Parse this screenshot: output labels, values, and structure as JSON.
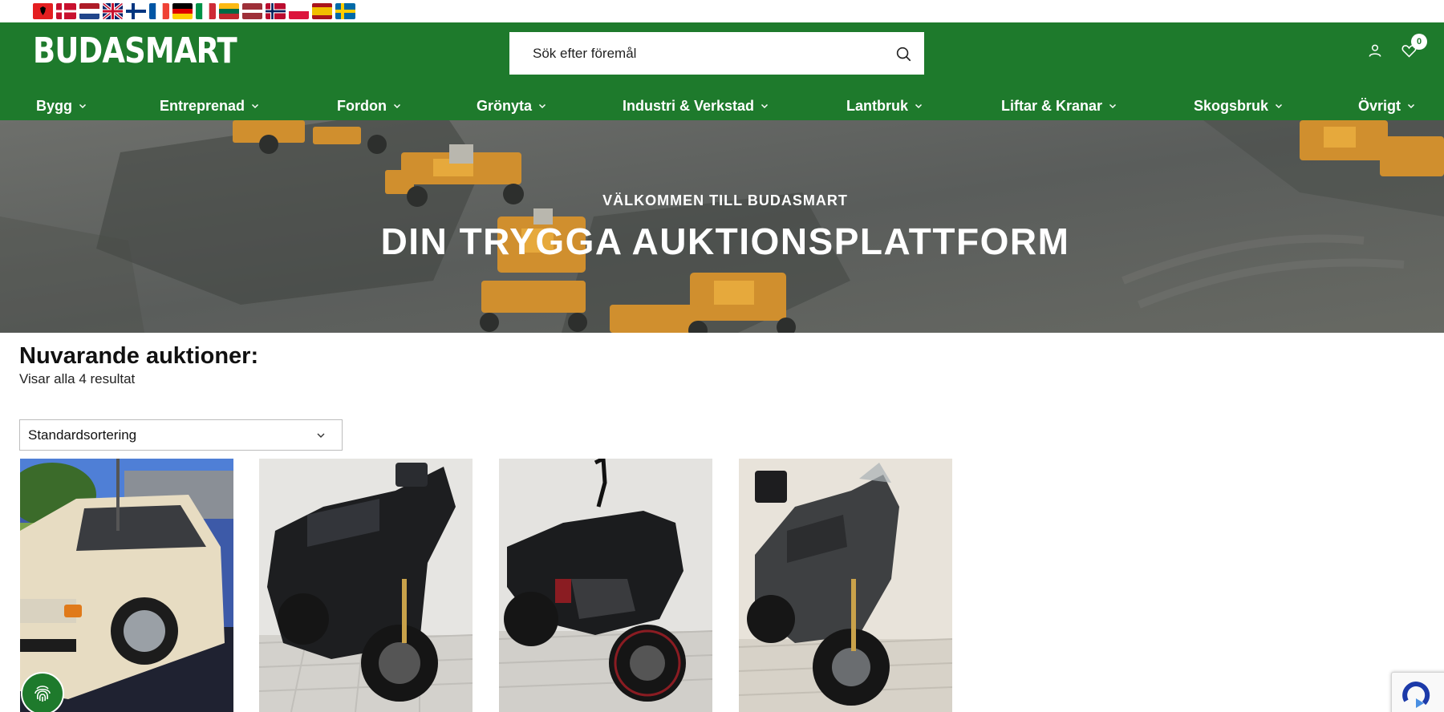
{
  "languages": [
    {
      "name": "albanian-flag",
      "code": "sq"
    },
    {
      "name": "danish-flag",
      "code": "da"
    },
    {
      "name": "dutch-flag",
      "code": "nl"
    },
    {
      "name": "english-flag",
      "code": "en"
    },
    {
      "name": "finnish-flag",
      "code": "fi"
    },
    {
      "name": "french-flag",
      "code": "fr"
    },
    {
      "name": "german-flag",
      "code": "de"
    },
    {
      "name": "italian-flag",
      "code": "it"
    },
    {
      "name": "lithuanian-flag",
      "code": "lt"
    },
    {
      "name": "latvian-flag",
      "code": "lv"
    },
    {
      "name": "norwegian-flag",
      "code": "no"
    },
    {
      "name": "polish-flag",
      "code": "pl"
    },
    {
      "name": "spanish-flag",
      "code": "es"
    },
    {
      "name": "swedish-flag",
      "code": "sv"
    }
  ],
  "header": {
    "logo": "BUDASMART",
    "search_placeholder": "Sök efter föremål",
    "wishlist_count": "0",
    "colors": {
      "brand": "#1e7a2c",
      "text_on_brand": "#ffffff"
    },
    "icons": [
      "search-icon",
      "user-icon",
      "heart-icon"
    ]
  },
  "nav": {
    "items": [
      {
        "label": "Bygg"
      },
      {
        "label": "Entreprenad"
      },
      {
        "label": "Fordon"
      },
      {
        "label": "Grönyta"
      },
      {
        "label": "Industri & Verkstad"
      },
      {
        "label": "Lantbruk"
      },
      {
        "label": "Liftar & Kranar"
      },
      {
        "label": "Skogsbruk"
      },
      {
        "label": "Övrigt"
      }
    ]
  },
  "hero": {
    "subtitle": "VÄLKOMMEN TILL BUDASMART",
    "title": "DIN TRYGGA AUKTIONSPLATTFORM"
  },
  "main": {
    "section_title": "Nuvarande auktioner:",
    "result_count": "Visar alla 4 resultat",
    "sort_selected": "Standardsortering",
    "products": [
      {
        "name": "product-card-car"
      },
      {
        "name": "product-card-scooter"
      },
      {
        "name": "product-card-motorcycle"
      },
      {
        "name": "product-card-adventure-scooter"
      }
    ]
  }
}
